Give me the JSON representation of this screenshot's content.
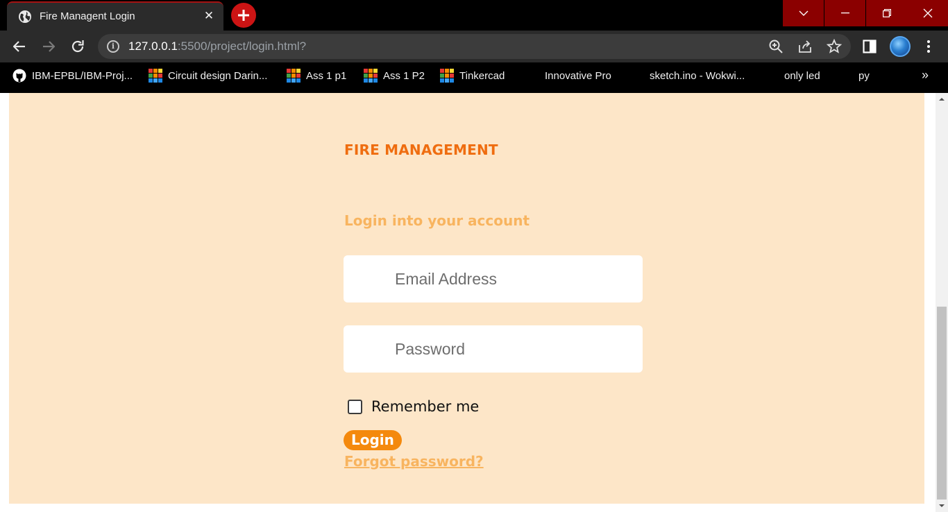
{
  "browser": {
    "tab": {
      "title": "Fire Managent Login",
      "favicon": "globe-icon"
    },
    "new_tab_icon": "plus-icon",
    "window_controls": [
      "chevron-down-icon",
      "minimize-icon",
      "restore-icon",
      "close-icon"
    ],
    "address_bar": {
      "host": "127.0.0.1",
      "rest": ":5500/project/login.html?"
    },
    "bookmarks": [
      {
        "label": "IBM-EPBL/IBM-Proj...",
        "icon": "github-icon"
      },
      {
        "label": "Circuit design Darin...",
        "icon": "tinkercad-icon"
      },
      {
        "label": "Ass 1 p1",
        "icon": "tinkercad-icon"
      },
      {
        "label": "Ass 1 P2",
        "icon": "tinkercad-icon"
      },
      {
        "label": "Tinkercad",
        "icon": "tinkercad-icon"
      },
      {
        "label": "Innovative Pro",
        "icon": ""
      },
      {
        "label": "sketch.ino - Wokwi...",
        "icon": ""
      },
      {
        "label": "only led",
        "icon": ""
      },
      {
        "label": "py",
        "icon": ""
      }
    ],
    "bookmarks_more": "»"
  },
  "page": {
    "brand": "FIRE MANAGEMENT",
    "subtitle": "Login into your account",
    "email_placeholder": "Email Address",
    "password_placeholder": "Password",
    "remember_label": "Remember me",
    "remember_checked": false,
    "login_label": "Login",
    "forgot_label": "Forgot password?",
    "colors": {
      "background": "#fde6c8",
      "brand": "#ef6d10",
      "accent": "#f8b45f",
      "button": "#f4890d"
    }
  }
}
